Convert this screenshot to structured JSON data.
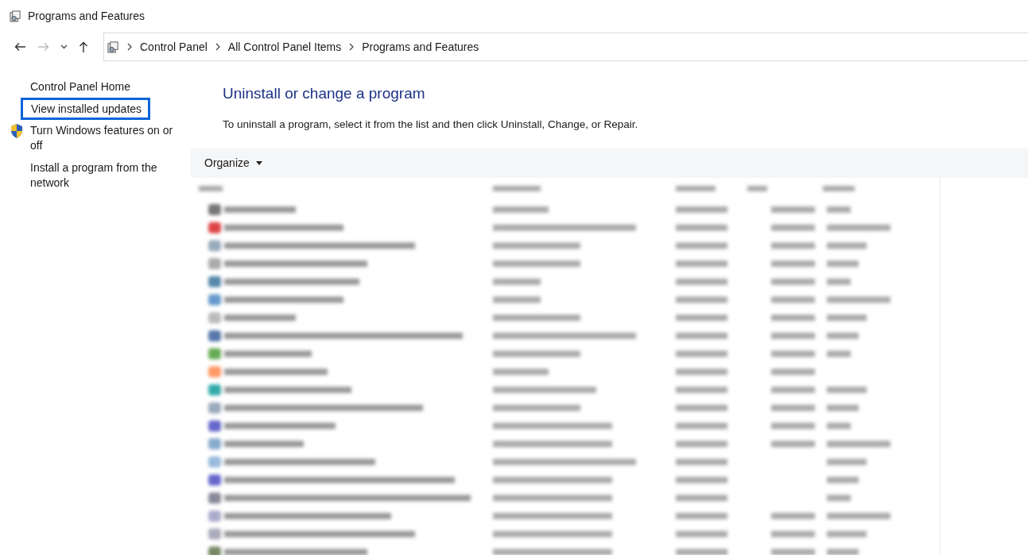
{
  "window": {
    "title": "Programs and Features"
  },
  "address_bar": {
    "breadcrumbs": [
      "Control Panel",
      "All Control Panel Items",
      "Programs and Features"
    ]
  },
  "sidebar": {
    "items": [
      {
        "label": "Control Panel Home",
        "kind": "plain",
        "focused": false
      },
      {
        "label": "View installed updates",
        "kind": "plain",
        "focused": true
      },
      {
        "label": "Turn Windows features on or off",
        "kind": "shield",
        "focused": false
      },
      {
        "label": "Install a program from the network",
        "kind": "plain",
        "focused": false
      }
    ]
  },
  "content": {
    "heading": "Uninstall or change a program",
    "instruction": "To uninstall a program, select it from the list and then click Uninstall, Change, or Repair."
  },
  "toolbar": {
    "organize": "Organize"
  }
}
